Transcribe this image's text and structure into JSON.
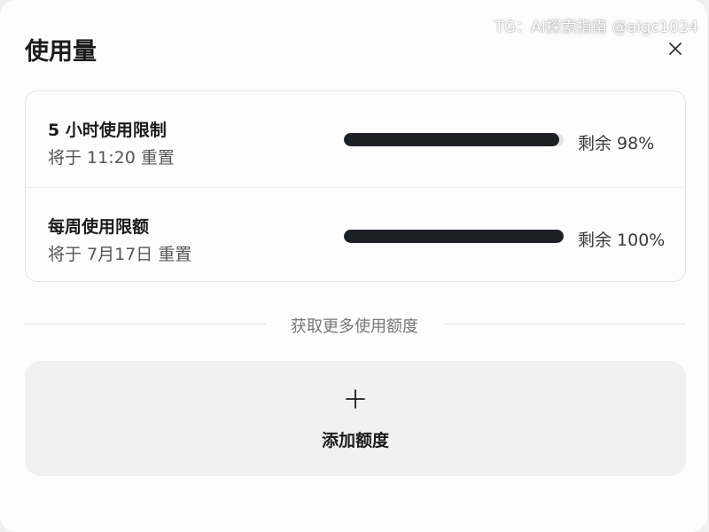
{
  "watermark": "TG：AI探索指南 @aigc1024",
  "dialog": {
    "title": "使用量"
  },
  "limits": [
    {
      "name": "5 小时使用限制",
      "reset": "将于 11:20 重置",
      "remaining_fraction": 0.98,
      "remaining_text": "剩余 98%"
    },
    {
      "name": "每周使用限额",
      "reset": "将于 7月17日 重置",
      "remaining_fraction": 1.0,
      "remaining_text": "剩余 100%"
    }
  ],
  "section": {
    "divider_label": "获取更多使用额度"
  },
  "add_card": {
    "label": "添加额度"
  },
  "colors": {
    "bar_fill": "#1c1f23",
    "bar_track": "#e6e6e6",
    "card_bg": "#f1f1f1"
  },
  "icons": {
    "close": "close-icon",
    "add": "plus-icon"
  }
}
